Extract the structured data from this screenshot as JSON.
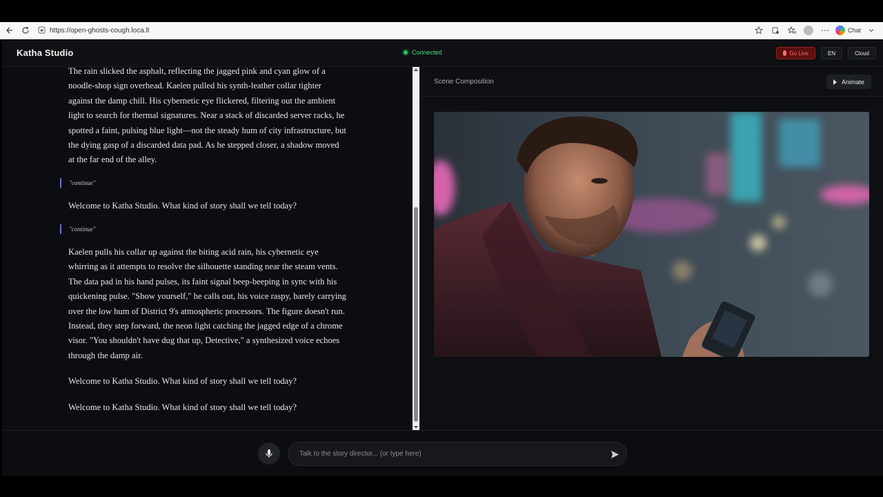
{
  "browser": {
    "url": "https://open-ghosts-cough.loca.lt",
    "chat_label": "Chat"
  },
  "header": {
    "logo": "Katha Studio",
    "status": "Connected",
    "go_live": "Go Live",
    "language": "EN",
    "cloud": "Cloud"
  },
  "story": {
    "paragraph1": "The rain slicked the asphalt, reflecting the jagged pink and cyan glow of a noodle-shop sign overhead. Kaelen pulled his synth-leather collar tighter against the damp chill. His cybernetic eye flickered, filtering out the ambient light to search for thermal signatures. Near a stack of discarded server racks, he spotted a faint, pulsing blue light—not the steady hum of city infrastructure, but the dying gasp of a discarded data pad. As he stepped closer, a shadow moved at the far end of the alley.",
    "continue1": "\"continue\"",
    "welcome1": "Welcome to Katha Studio. What kind of story shall we tell today?",
    "continue2": "\"continue\"",
    "paragraph2": "Kaelen pulls his collar up against the biting acid rain, his cybernetic eye whirring as it attempts to resolve the silhouette standing near the steam vents. The data pad in his hand pulses, its faint signal beep-beeping in sync with his quickening pulse. \"Show yourself,\" he calls out, his voice raspy, barely carrying over the low hum of District 9's atmospheric processors. The figure doesn't run. Instead, they step forward, the neon light catching the jagged edge of a chrome visor. \"You shouldn't have dug that up, Detective,\" a synthesized voice echoes through the damp air.",
    "welcome2": "Welcome to Katha Studio. What kind of story shall we tell today?",
    "welcome3": "Welcome to Katha Studio. What kind of story shall we tell today?"
  },
  "scene": {
    "title": "Scene Composition",
    "animate_label": "Animate"
  },
  "composer": {
    "placeholder": "Talk to the story director... (or type here)"
  },
  "colors": {
    "accent_green": "#22c55e",
    "live_red": "#9b1c1c",
    "continue_bar": "#6d6fd8"
  }
}
